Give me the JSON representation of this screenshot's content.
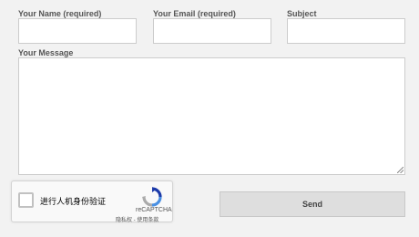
{
  "form": {
    "name_label": "Your Name (required)",
    "email_label": "Your Email (required)",
    "subject_label": "Subject",
    "message_label": "Your Message",
    "name_value": "",
    "email_value": "",
    "subject_value": "",
    "message_value": "",
    "send_label": "Send"
  },
  "recaptcha": {
    "checkbox_label": "进行人机身份验证",
    "brand": "reCAPTCHA",
    "privacy_link": "隐私权",
    "separator": " - ",
    "terms_link": "使用条款",
    "logo_icon": "recaptcha-logo-icon"
  }
}
